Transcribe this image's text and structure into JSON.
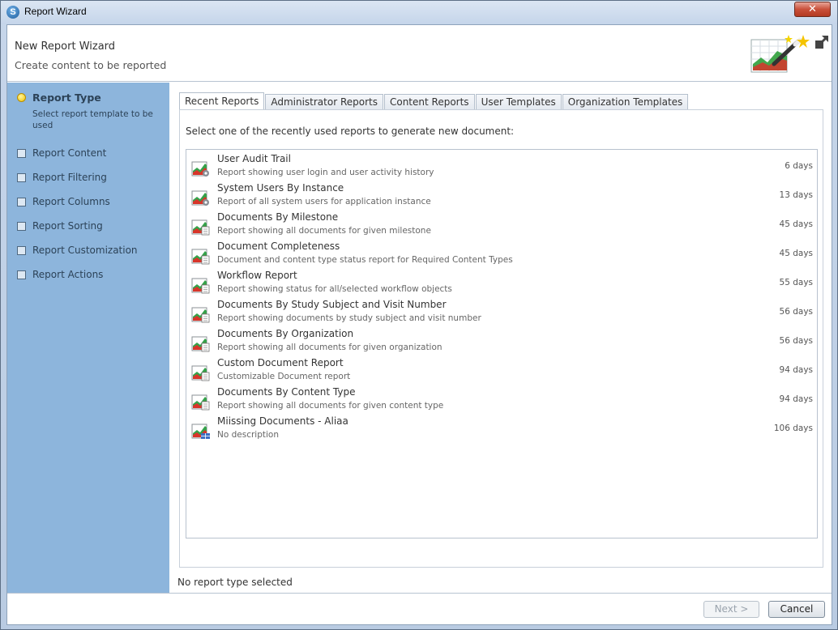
{
  "window": {
    "title": "Report Wizard",
    "close_label": "✕"
  },
  "header": {
    "title": "New Report Wizard",
    "subtitle": "Create content to be reported"
  },
  "steps": [
    {
      "label": "Report Type",
      "description": "Select report template to be used",
      "active": true
    },
    {
      "label": "Report Content"
    },
    {
      "label": "Report Filtering"
    },
    {
      "label": "Report Columns"
    },
    {
      "label": "Report Sorting"
    },
    {
      "label": "Report Customization"
    },
    {
      "label": "Report Actions"
    }
  ],
  "tabs": [
    "Recent Reports",
    "Administrator Reports",
    "Content Reports",
    "User Templates",
    "Organization Templates"
  ],
  "active_tab": "Recent Reports",
  "instruction": "Select one of the recently used reports to generate new document:",
  "reports": [
    {
      "title": "User Audit Trail",
      "description": "Report showing user login and user activity history",
      "age": "6 days",
      "icon": "report-gear-icon"
    },
    {
      "title": "System Users By Instance",
      "description": "Report of all system users for application instance",
      "age": "13 days",
      "icon": "report-gear-icon"
    },
    {
      "title": "Documents By Milestone",
      "description": "Report showing all documents for given milestone",
      "age": "45 days",
      "icon": "report-document-icon"
    },
    {
      "title": "Document Completeness",
      "description": "Document and content type status report for Required Content Types",
      "age": "45 days",
      "icon": "report-document-icon"
    },
    {
      "title": "Workflow Report",
      "description": "Report showing status for all/selected workflow objects",
      "age": "55 days",
      "icon": "report-document-icon"
    },
    {
      "title": "Documents By Study Subject and Visit Number",
      "description": "Report showing documents by study subject and visit number",
      "age": "56 days",
      "icon": "report-document-icon"
    },
    {
      "title": "Documents By Organization",
      "description": "Report showing all documents for given organization",
      "age": "56 days",
      "icon": "report-document-icon"
    },
    {
      "title": "Custom Document Report",
      "description": "Customizable Document report",
      "age": "94 days",
      "icon": "report-document-icon"
    },
    {
      "title": "Documents By Content Type",
      "description": "Report showing all documents for given content type",
      "age": "94 days",
      "icon": "report-document-icon"
    },
    {
      "title": "Miissing Documents - Aliaa",
      "description": "No description",
      "age": "106 days",
      "icon": "report-table-icon"
    }
  ],
  "status": "No report type selected",
  "buttons": {
    "next": "Next >",
    "cancel": "Cancel"
  },
  "colors": {
    "sidebar": "#8db5dc",
    "accent": "#f3c200"
  }
}
